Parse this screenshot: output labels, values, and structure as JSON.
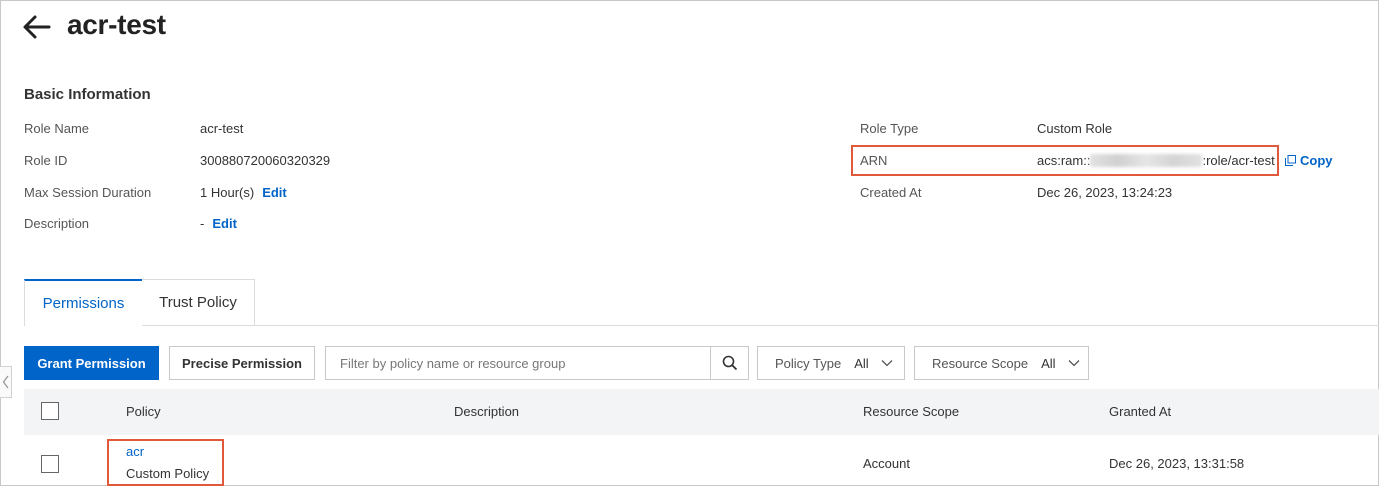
{
  "header": {
    "title": "acr-test"
  },
  "basic_info": {
    "section_title": "Basic Information",
    "left": [
      {
        "label": "Role Name",
        "value": "acr-test"
      },
      {
        "label": "Role ID",
        "value": "300880720060320329"
      },
      {
        "label": "Max Session Duration",
        "value": "1 Hour(s)",
        "action": "Edit"
      },
      {
        "label": "Description",
        "value": "-",
        "action": "Edit"
      }
    ],
    "right": [
      {
        "label": "Role Type",
        "value": "Custom Role"
      },
      {
        "label": "ARN",
        "value_prefix": "acs:ram::",
        "value_suffix": ":role/acr-test",
        "action": "Copy"
      },
      {
        "label": "Created At",
        "value": "Dec 26, 2023, 13:24:23"
      }
    ]
  },
  "tabs": [
    {
      "label": "Permissions",
      "active": true
    },
    {
      "label": "Trust Policy",
      "active": false
    }
  ],
  "toolbar": {
    "grant_label": "Grant Permission",
    "precise_label": "Precise Permission",
    "search_placeholder": "Filter by policy name or resource group",
    "policy_type": {
      "label": "Policy Type",
      "value": "All"
    },
    "resource_scope": {
      "label": "Resource Scope",
      "value": "All"
    }
  },
  "table": {
    "columns": [
      "Policy",
      "Description",
      "Resource Scope",
      "Granted At"
    ],
    "rows": [
      {
        "policy_name": "acr",
        "policy_type": "Custom Policy",
        "description": "",
        "resource_scope": "Account",
        "granted_at": "Dec 26, 2023, 13:31:58"
      }
    ]
  },
  "colors": {
    "accent": "#0064c8",
    "highlight": "#e0593b"
  }
}
